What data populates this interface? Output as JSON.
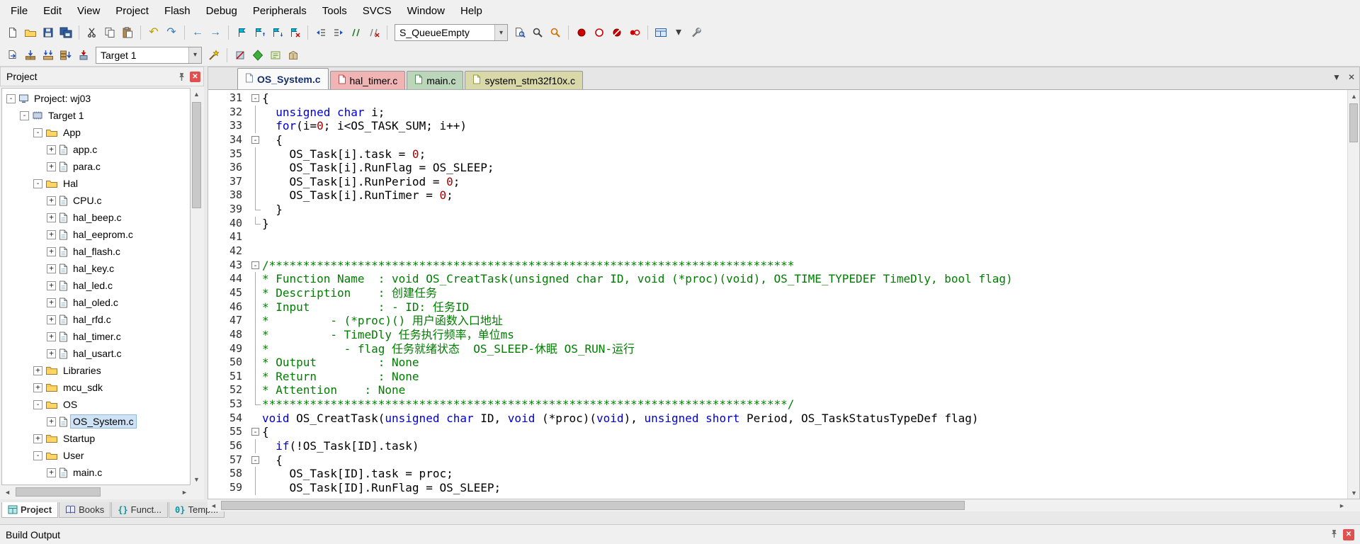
{
  "colors": {
    "keyword": "#0000d0",
    "number": "#aa0000",
    "comment": "#007d00",
    "selection": "#cfe3f7",
    "active_tab_text": "#15306e",
    "tab_pink": "#f0b4b4",
    "tab_green": "#bcd6bc",
    "tab_yellow": "#d8d8a8"
  },
  "menu_bar": {
    "items": [
      "File",
      "Edit",
      "View",
      "Project",
      "Flash",
      "Debug",
      "Peripherals",
      "Tools",
      "SVCS",
      "Window",
      "Help"
    ]
  },
  "toolbar_standard": {
    "buttons": [
      {
        "name": "new-file-icon",
        "icon": "page"
      },
      {
        "name": "open-file-icon",
        "icon": "folderOpen"
      },
      {
        "name": "save-icon",
        "icon": "floppy"
      },
      {
        "name": "save-all-icon",
        "icon": "floppyAll"
      },
      {
        "type": "sep"
      },
      {
        "name": "cut-icon",
        "icon": "scissors"
      },
      {
        "name": "copy-icon",
        "icon": "copy"
      },
      {
        "name": "paste-icon",
        "icon": "paste"
      },
      {
        "type": "sep"
      },
      {
        "name": "undo-icon",
        "glyph": "↶",
        "color": "#b8a000"
      },
      {
        "name": "redo-icon",
        "glyph": "↷",
        "color": "#3a7ab8"
      },
      {
        "type": "sep"
      },
      {
        "name": "navigate-back-icon",
        "glyph": "←",
        "color": "#2e7db0"
      },
      {
        "name": "navigate-forward-icon",
        "glyph": "→",
        "color": "#2e7db0"
      },
      {
        "type": "sep"
      },
      {
        "name": "bookmark-toggle-icon",
        "icon": "flag"
      },
      {
        "name": "bookmark-prev-icon",
        "icon": "flagPrev"
      },
      {
        "name": "bookmark-next-icon",
        "icon": "flagNext"
      },
      {
        "name": "bookmark-clear-all-icon",
        "icon": "flagClear"
      },
      {
        "type": "sep"
      },
      {
        "name": "unindent-icon",
        "icon": "indentL"
      },
      {
        "name": "indent-icon",
        "icon": "indentR"
      },
      {
        "name": "comment-selection-icon",
        "icon": "comment"
      },
      {
        "name": "uncomment-selection-icon",
        "icon": "uncomment"
      },
      {
        "type": "sep"
      },
      {
        "type": "combo",
        "name": "symbol-combo",
        "value": "S_QueueEmpty",
        "width": 160
      },
      {
        "name": "lookup-symbol-icon",
        "icon": "pageMag"
      },
      {
        "name": "find-in-files-icon",
        "icon": "mag"
      },
      {
        "name": "incremental-find-icon",
        "icon": "magOrange"
      },
      {
        "type": "sep"
      },
      {
        "name": "insert-breakpoint-icon",
        "icon": "dotRed"
      },
      {
        "name": "enable-disable-breakpoint-icon",
        "icon": "dotGray"
      },
      {
        "name": "kill-all-breakpoints-icon",
        "icon": "dotSlash"
      },
      {
        "name": "disable-all-breakpoints-icon",
        "icon": "dotPair"
      },
      {
        "type": "sep"
      },
      {
        "name": "window-layout-icon",
        "icon": "gridBlue"
      },
      {
        "name": "window-layout-dropdown-icon",
        "glyph": "▾",
        "color": "#404040"
      },
      {
        "name": "configure-icon",
        "icon": "wrench"
      }
    ]
  },
  "toolbar_build": {
    "buttons": [
      {
        "name": "translate-file-icon",
        "icon": "translate"
      },
      {
        "name": "build-icon",
        "icon": "build"
      },
      {
        "name": "rebuild-all-icon",
        "icon": "rebuild"
      },
      {
        "name": "batch-build-icon",
        "icon": "batch"
      },
      {
        "name": "download-icon",
        "icon": "load"
      },
      {
        "type": "combo",
        "name": "target-combo",
        "value": "Target 1",
        "width": 150
      },
      {
        "name": "options-for-target-icon",
        "icon": "wand"
      },
      {
        "type": "sep"
      },
      {
        "name": "flash-download-icon",
        "icon": "erase"
      },
      {
        "name": "manage-rte-icon",
        "icon": "rte"
      },
      {
        "name": "file-extensions-icon",
        "icon": "ext"
      },
      {
        "name": "pack-installer-icon",
        "icon": "pack"
      }
    ]
  },
  "project_panel": {
    "title": "Project",
    "tree": [
      {
        "label": "Project: wj03",
        "lvl": 0,
        "exp": "minus",
        "icon": "project"
      },
      {
        "label": "Target 1",
        "lvl": 1,
        "exp": "minus",
        "icon": "target"
      },
      {
        "label": "App",
        "lvl": 2,
        "exp": "minus",
        "icon": "folderOpen"
      },
      {
        "label": "app.c",
        "lvl": 3,
        "exp": "plus",
        "icon": "file"
      },
      {
        "label": "para.c",
        "lvl": 3,
        "exp": "plus",
        "icon": "file"
      },
      {
        "label": "Hal",
        "lvl": 2,
        "exp": "minus",
        "icon": "folderOpen"
      },
      {
        "label": "CPU.c",
        "lvl": 3,
        "exp": "plus",
        "icon": "file"
      },
      {
        "label": "hal_beep.c",
        "lvl": 3,
        "exp": "plus",
        "icon": "file"
      },
      {
        "label": "hal_eeprom.c",
        "lvl": 3,
        "exp": "plus",
        "icon": "file"
      },
      {
        "label": "hal_flash.c",
        "lvl": 3,
        "exp": "plus",
        "icon": "file"
      },
      {
        "label": "hal_key.c",
        "lvl": 3,
        "exp": "plus",
        "icon": "file"
      },
      {
        "label": "hal_led.c",
        "lvl": 3,
        "exp": "plus",
        "icon": "file"
      },
      {
        "label": "hal_oled.c",
        "lvl": 3,
        "exp": "plus",
        "icon": "file"
      },
      {
        "label": "hal_rfd.c",
        "lvl": 3,
        "exp": "plus",
        "icon": "file"
      },
      {
        "label": "hal_timer.c",
        "lvl": 3,
        "exp": "plus",
        "icon": "file"
      },
      {
        "label": "hal_usart.c",
        "lvl": 3,
        "exp": "plus",
        "icon": "file"
      },
      {
        "label": "Libraries",
        "lvl": 2,
        "exp": "plus",
        "icon": "folderClosed"
      },
      {
        "label": "mcu_sdk",
        "lvl": 2,
        "exp": "plus",
        "icon": "folderClosed"
      },
      {
        "label": "OS",
        "lvl": 2,
        "exp": "minus",
        "icon": "folderOpen"
      },
      {
        "label": "OS_System.c",
        "lvl": 3,
        "exp": "plus",
        "icon": "file",
        "sel": true
      },
      {
        "label": "Startup",
        "lvl": 2,
        "exp": "plus",
        "icon": "folderClosed"
      },
      {
        "label": "User",
        "lvl": 2,
        "exp": "minus",
        "icon": "folderOpen"
      },
      {
        "label": "main.c",
        "lvl": 3,
        "exp": "plus",
        "icon": "file"
      }
    ]
  },
  "editor": {
    "tabs": [
      {
        "label": "OS_System.c",
        "active": true,
        "bg": "#fafafa",
        "icon_color": "#7a90a8"
      },
      {
        "label": "hal_timer.c",
        "bg": "#f0b4b4",
        "icon_color": "#c05050"
      },
      {
        "label": "main.c",
        "bg": "#bcd6bc",
        "icon_color": "#4f8f4f"
      },
      {
        "label": "system_stm32f10x.c",
        "bg": "#d8d8a8",
        "icon_color": "#9a9a40"
      }
    ],
    "code_lines": [
      {
        "n": 31,
        "f": "open",
        "s": [
          [
            "p",
            "{"
          ]
        ]
      },
      {
        "n": 32,
        "f": "line",
        "s": [
          [
            "p",
            "  "
          ],
          [
            "k",
            "unsigned"
          ],
          [
            "p",
            " "
          ],
          [
            "k",
            "char"
          ],
          [
            "p",
            " i;"
          ]
        ]
      },
      {
        "n": 33,
        "f": "line",
        "s": [
          [
            "p",
            "  "
          ],
          [
            "k",
            "for"
          ],
          [
            "p",
            "(i="
          ],
          [
            "n",
            "0"
          ],
          [
            "p",
            "; i<OS_TASK_SUM; i++)"
          ]
        ]
      },
      {
        "n": 34,
        "f": "open",
        "s": [
          [
            "p",
            "  {"
          ]
        ]
      },
      {
        "n": 35,
        "f": "line",
        "s": [
          [
            "p",
            "    OS_Task[i].task = "
          ],
          [
            "n",
            "0"
          ],
          [
            "p",
            ";"
          ]
        ]
      },
      {
        "n": 36,
        "f": "line",
        "s": [
          [
            "p",
            "    OS_Task[i].RunFlag = OS_SLEEP;"
          ]
        ]
      },
      {
        "n": 37,
        "f": "line",
        "s": [
          [
            "p",
            "    OS_Task[i].RunPeriod = "
          ],
          [
            "n",
            "0"
          ],
          [
            "p",
            ";"
          ]
        ]
      },
      {
        "n": 38,
        "f": "line",
        "s": [
          [
            "p",
            "    OS_Task[i].RunTimer = "
          ],
          [
            "n",
            "0"
          ],
          [
            "p",
            ";"
          ]
        ]
      },
      {
        "n": 39,
        "f": "end",
        "s": [
          [
            "p",
            "  }"
          ]
        ]
      },
      {
        "n": 40,
        "f": "end",
        "s": [
          [
            "p",
            "}"
          ]
        ]
      },
      {
        "n": 41,
        "f": "none",
        "s": []
      },
      {
        "n": 42,
        "f": "none",
        "s": []
      },
      {
        "n": 43,
        "f": "open",
        "s": [
          [
            "c",
            "/*****************************************************************************"
          ]
        ]
      },
      {
        "n": 44,
        "f": "line",
        "s": [
          [
            "c",
            "* Function Name  : void OS_CreatTask(unsigned char ID, void (*proc)(void), OS_TIME_TYPEDEF TimeDly, bool flag)"
          ]
        ]
      },
      {
        "n": 45,
        "f": "line",
        "s": [
          [
            "c",
            "* Description    : 创建任务"
          ]
        ]
      },
      {
        "n": 46,
        "f": "line",
        "s": [
          [
            "c",
            "* Input          : - ID: 任务ID"
          ]
        ]
      },
      {
        "n": 47,
        "f": "line",
        "s": [
          [
            "c",
            "*         - (*proc)() 用户函数入口地址"
          ]
        ]
      },
      {
        "n": 48,
        "f": "line",
        "s": [
          [
            "c",
            "*         - TimeDly 任务执行频率，单位ms"
          ]
        ]
      },
      {
        "n": 49,
        "f": "line",
        "s": [
          [
            "c",
            "*           - flag 任务就绪状态  OS_SLEEP-休眠 OS_RUN-运行"
          ]
        ]
      },
      {
        "n": 50,
        "f": "line",
        "s": [
          [
            "c",
            "* Output         : None"
          ]
        ]
      },
      {
        "n": 51,
        "f": "line",
        "s": [
          [
            "c",
            "* Return         : None"
          ]
        ]
      },
      {
        "n": 52,
        "f": "line",
        "s": [
          [
            "c",
            "* Attention    : None"
          ]
        ]
      },
      {
        "n": 53,
        "f": "end",
        "s": [
          [
            "c",
            "*****************************************************************************/"
          ]
        ]
      },
      {
        "n": 54,
        "f": "none",
        "s": [
          [
            "k",
            "void"
          ],
          [
            "p",
            " OS_CreatTask("
          ],
          [
            "k",
            "unsigned"
          ],
          [
            "p",
            " "
          ],
          [
            "k",
            "char"
          ],
          [
            "p",
            " ID, "
          ],
          [
            "k",
            "void"
          ],
          [
            "p",
            " (*proc)("
          ],
          [
            "k",
            "void"
          ],
          [
            "p",
            "), "
          ],
          [
            "k",
            "unsigned"
          ],
          [
            "p",
            " "
          ],
          [
            "k",
            "short"
          ],
          [
            "p",
            " Period, OS_TaskStatusTypeDef flag)"
          ]
        ]
      },
      {
        "n": 55,
        "f": "open",
        "s": [
          [
            "p",
            "{"
          ]
        ]
      },
      {
        "n": 56,
        "f": "line",
        "s": [
          [
            "p",
            "  "
          ],
          [
            "k",
            "if"
          ],
          [
            "p",
            "(!OS_Task[ID].task)"
          ]
        ]
      },
      {
        "n": 57,
        "f": "open",
        "s": [
          [
            "p",
            "  {"
          ]
        ]
      },
      {
        "n": 58,
        "f": "line",
        "s": [
          [
            "p",
            "    OS_Task[ID].task = proc;"
          ]
        ]
      },
      {
        "n": 59,
        "f": "line",
        "s": [
          [
            "p",
            "    OS_Task[ID].RunFlag = OS_SLEEP;"
          ]
        ]
      }
    ]
  },
  "bottom_tabs": [
    {
      "label": "Project",
      "icon": "gridTeal",
      "active": true
    },
    {
      "label": "Books",
      "icon": "book"
    },
    {
      "label": "Funct...",
      "glyph": "{}",
      "color": "#0a96a0"
    },
    {
      "label": "Temp...",
      "glyph": "0}",
      "color": "#0a96a0"
    }
  ],
  "status_bar": {
    "text": "Build Output"
  }
}
